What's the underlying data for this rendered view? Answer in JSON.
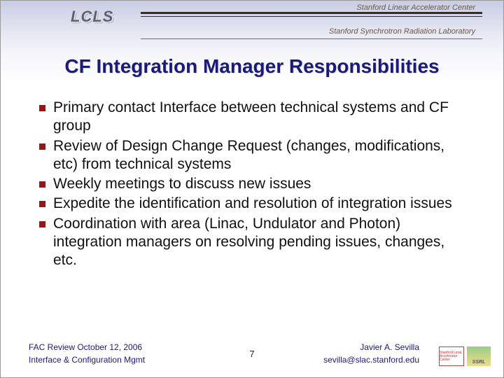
{
  "header": {
    "logo_text": "LCLS",
    "lab_line1": "Stanford Linear Accelerator Center",
    "lab_line2": "Stanford Synchrotron Radiation Laboratory"
  },
  "title": "CF Integration Manager Responsibilities",
  "bullets": [
    "Primary contact Interface between technical systems and CF group",
    "Review of Design Change Request (changes, modifications, etc) from technical systems",
    "Weekly meetings to discuss new issues",
    "Expedite the identification and resolution of integration issues",
    "Coordination with area (Linac, Undulator and Photon) integration managers on resolving pending issues, changes, etc."
  ],
  "footer": {
    "event": "FAC Review October 12, 2006",
    "topic": "Interface & Configuration Mgmt",
    "page": "7",
    "author": "Javier A. Sevilla",
    "email": "sevilla@slac.stanford.edu",
    "logo1_lines": "Stanford\nLinac\nAccelerator\nCenter",
    "logo2_text": "SSRL"
  }
}
